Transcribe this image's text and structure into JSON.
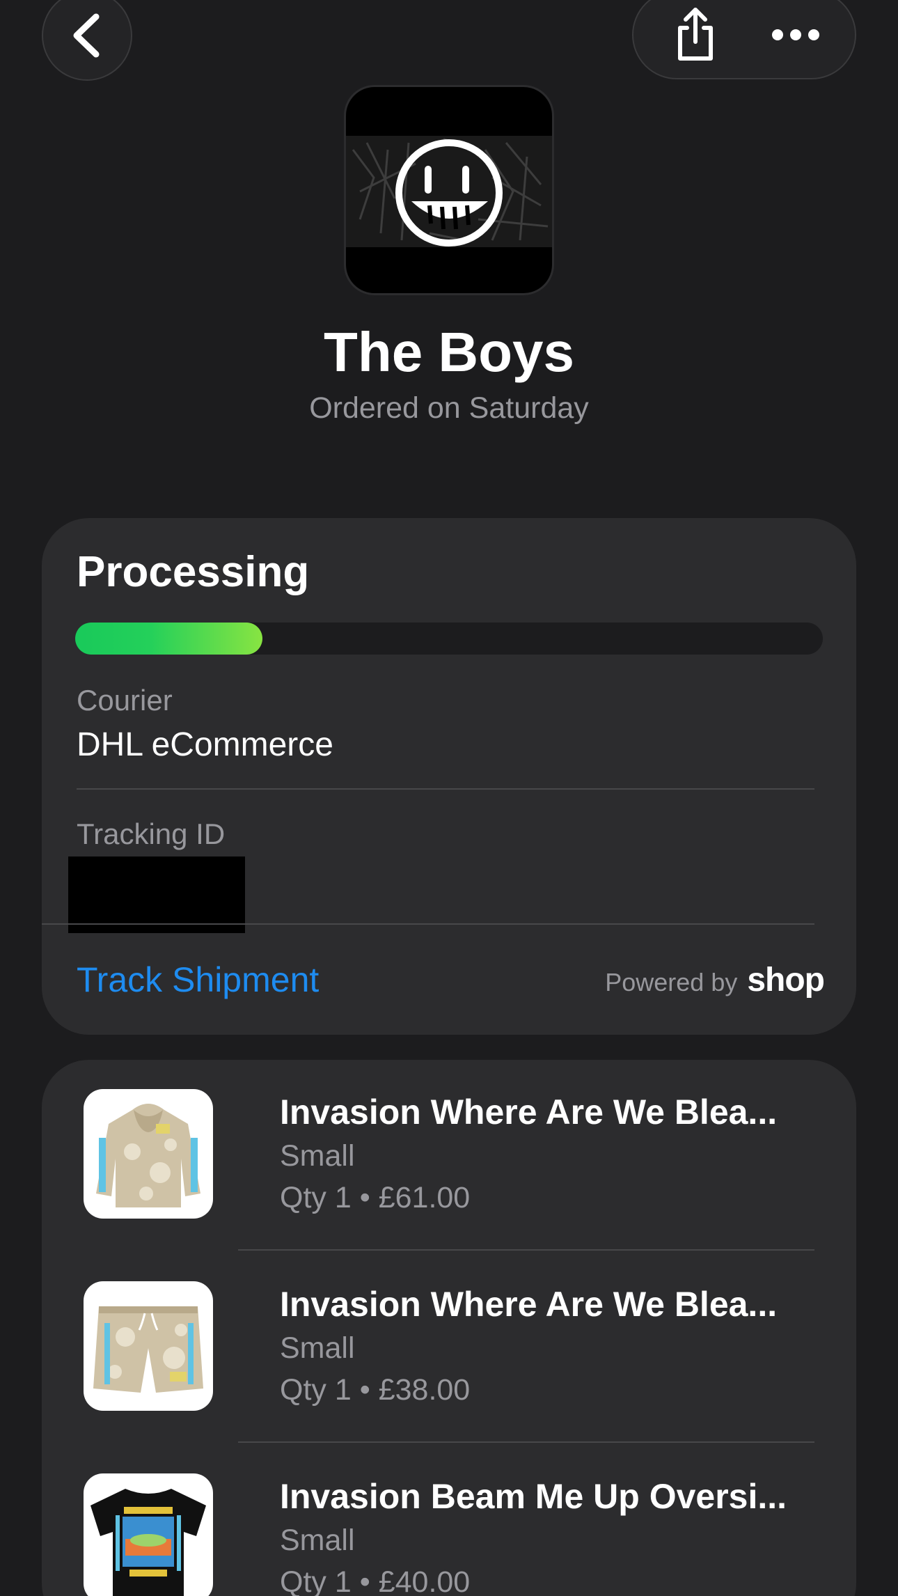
{
  "nav": {
    "back_icon": "chevron-left-icon",
    "share_icon": "share-icon",
    "more_icon": "ellipsis-icon"
  },
  "store": {
    "name": "The Boys",
    "ordered": "Ordered on Saturday",
    "logo_icon": "grin-face-logo"
  },
  "status": {
    "title": "Processing",
    "progress_fraction": 0.25,
    "courier_label": "Courier",
    "courier_value": "DHL eCommerce",
    "tracking_label": "Tracking ID",
    "track_link": "Track Shipment",
    "powered_by": "Powered by",
    "powered_brand": "shop"
  },
  "items": [
    {
      "name": "Invasion Where Are We Blea...",
      "variant": "Small",
      "price": "Qty 1 • £61.00",
      "thumb": "hoodie-thumbnail"
    },
    {
      "name": "Invasion Where Are We Blea...",
      "variant": "Small",
      "price": "Qty 1 • £38.00",
      "thumb": "shorts-thumbnail"
    },
    {
      "name": "Invasion Beam Me Up Oversi...",
      "variant": "Small",
      "price": "Qty 1 • £40.00",
      "thumb": "tshirt-thumbnail"
    }
  ],
  "colors": {
    "background": "#1c1c1e",
    "card": "#2c2c2e",
    "link": "#1e8cf0",
    "progress_start": "#19c95a",
    "progress_end": "#88e442"
  }
}
